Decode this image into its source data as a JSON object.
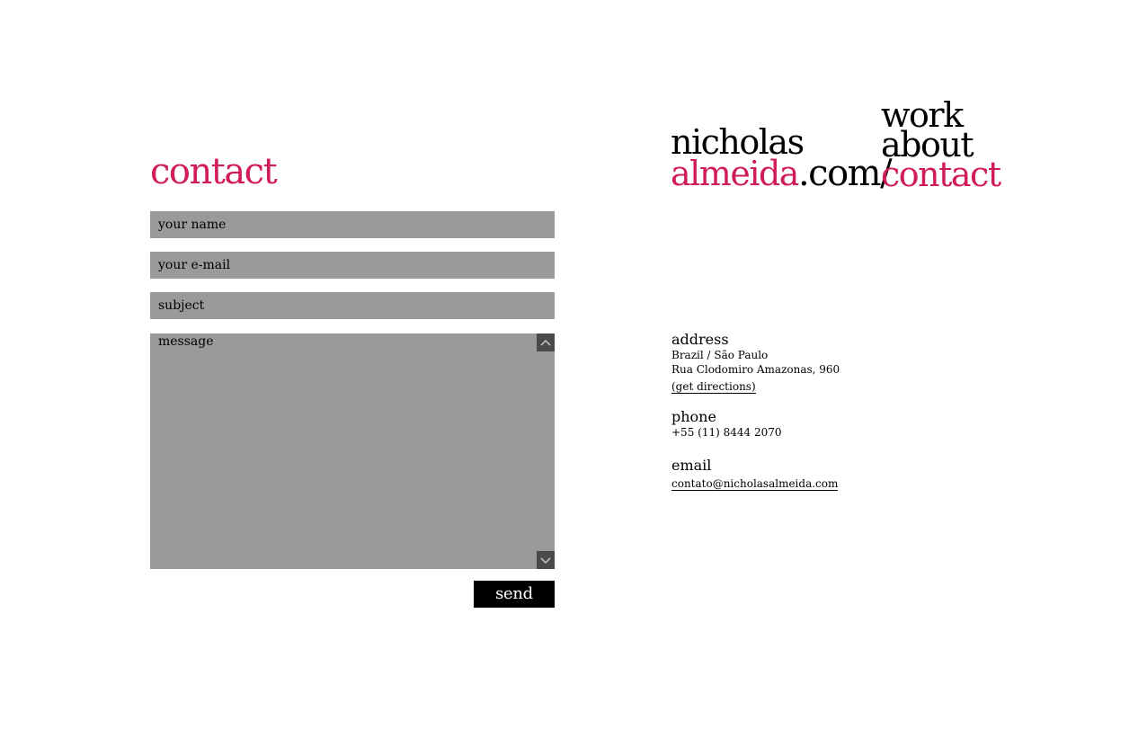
{
  "page": {
    "heading": "contact"
  },
  "form": {
    "name_placeholder": "your name",
    "email_placeholder": "your e-mail",
    "subject_placeholder": "subject",
    "message_placeholder": "message",
    "send_label": "send"
  },
  "logo": {
    "first": "nicholas",
    "last": "almeida",
    "domain": ".com/"
  },
  "nav": {
    "items": [
      {
        "label": "work"
      },
      {
        "label": "about"
      },
      {
        "label": "contact"
      }
    ]
  },
  "info": {
    "address": {
      "title": "address",
      "line1": "Brazil / São Paulo",
      "line2": "Rua Clodomiro Amazonas, 960",
      "directions_link": "(get directions)"
    },
    "phone": {
      "title": "phone",
      "number": "+55 (11) 8444 2070"
    },
    "email": {
      "title": "email",
      "address": "contato@nicholasalmeida.com"
    }
  },
  "colors": {
    "accent": "#d01c5b",
    "field_background": "#9a9a9a",
    "scroll_button": "#4a4a4a",
    "button_background": "#000000"
  },
  "icons": {
    "scroll_up": "chevron-up-icon",
    "scroll_down": "chevron-down-icon"
  }
}
